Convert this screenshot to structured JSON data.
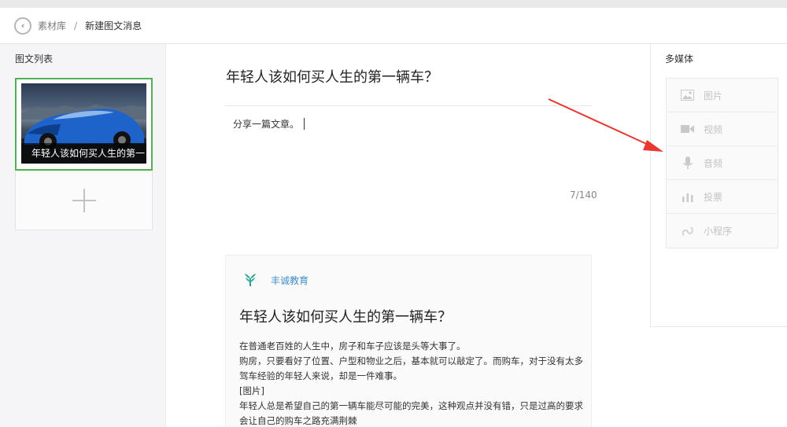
{
  "breadcrumb": {
    "back": "‹",
    "library": "素材库",
    "separator": "/",
    "current": "新建图文消息"
  },
  "article_list": {
    "title": "图文列表",
    "cards": [
      {
        "caption": "年轻人该如何买人生的第一辆车"
      }
    ],
    "add_icon": "plus-icon"
  },
  "editor": {
    "title_value": "年轻人该如何买人生的第一辆车？",
    "digest_value": "分享一篇文章。",
    "char_count": "7/140"
  },
  "preview": {
    "source_icon": "wheat-logo-icon",
    "source_name": "丰诚教育",
    "title": "年轻人该如何买人生的第一辆车？",
    "paragraphs": [
      "在普通老百姓的人生中，房子和车子应该是头等大事了。",
      "购房，只要看好了位置、户型和物业之后，基本就可以敲定了。而购车，对于没有太多驾车经验的年轻人来说，却是一件难事。",
      "[图片]",
      "年轻人总是希望自己的第一辆车能尽可能的完美，这种观点并没有错，只是过高的要求会让自己的购车之路充满荆棘"
    ]
  },
  "media": {
    "title": "多媒体",
    "items": [
      {
        "label": "图片",
        "icon": "image-icon"
      },
      {
        "label": "视频",
        "icon": "video-icon"
      },
      {
        "label": "音频",
        "icon": "microphone-icon"
      },
      {
        "label": "投票",
        "icon": "bar-chart-icon"
      },
      {
        "label": "小程序",
        "icon": "mini-program-icon"
      }
    ]
  },
  "colors": {
    "selected_border": "#52b153",
    "source_name": "#3f8fc8",
    "annotation_arrow": "#e8382f",
    "disabled_text": "#c3c3c3"
  }
}
